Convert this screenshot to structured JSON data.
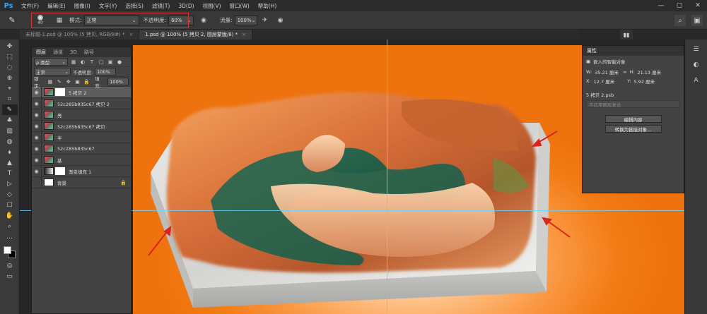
{
  "menu": {
    "logo": "Ps",
    "items": [
      "文件(F)",
      "编辑(E)",
      "图像(I)",
      "文字(Y)",
      "选择(S)",
      "滤镜(T)",
      "3D(D)",
      "视图(V)",
      "窗口(W)",
      "帮助(H)"
    ],
    "controls": [
      "—",
      "▢",
      "✕"
    ]
  },
  "options": {
    "brush_size": "40",
    "mode_label": "模式:",
    "mode_value": "正常",
    "opacity_label": "不透明度:",
    "opacity_value": "60%",
    "flow_label": "流量:",
    "flow_value": "100%"
  },
  "tabs": [
    {
      "label": "未标题-1.psd @ 100% (5 拷贝, RGB/8#) *",
      "close": "×"
    },
    {
      "label": "1.psd @ 100% (5 拷贝 2, 图层蒙版/8) *",
      "close": "×"
    }
  ],
  "layers_panel": {
    "tabs": [
      "图层",
      "通道",
      "3D",
      "路径"
    ],
    "filter_label": "ρ 类型",
    "blend_mode": "正常",
    "opacity_label": "不透明度:",
    "opacity_value": "100%",
    "lock_label": "锁定:",
    "fill_label": "填充:",
    "fill_value": "100%",
    "layers": [
      {
        "name": "5 拷贝 2",
        "thumb": "photo",
        "mask": true
      },
      {
        "name": "52c285b835c67 拷贝 2",
        "thumb": "photo"
      },
      {
        "name": "亮",
        "thumb": "photo"
      },
      {
        "name": "52c285b835c67 拷贝",
        "thumb": "photo"
      },
      {
        "name": "半",
        "thumb": "photo"
      },
      {
        "name": "52c285b835c67",
        "thumb": "photo"
      },
      {
        "name": "基",
        "thumb": "photo"
      },
      {
        "name": "渐变填充 1",
        "thumb": "grad"
      },
      {
        "name": "背景",
        "thumb": "white"
      }
    ]
  },
  "properties_panel": {
    "title": "属性",
    "subtitle": "嵌入的智能对象",
    "w_label": "W:",
    "w_value": "35.21 厘米",
    "h_label": "H:",
    "h_value": "21.13 厘米",
    "x_label": "X:",
    "x_value": "12.7 厘米",
    "y_label": "Y:",
    "y_value": "5.92 厘米",
    "file_name": "5 拷贝 2.psb",
    "comp_placeholder": "不应用图层复合",
    "edit_button": "编辑内容",
    "convert_button": "转换为链接对象..."
  },
  "tools": [
    "✥",
    "⬚",
    "◌",
    "⊕",
    "⌖",
    "⌗",
    "✎",
    "♣",
    "▥",
    "◍",
    "⬧",
    "▲",
    "T",
    "▷",
    "◇",
    "☐",
    "✋",
    "⌕",
    "…"
  ],
  "colors": {
    "accent": "#31a8ff",
    "canvas_orange": "#f27b14",
    "arrow": "#d9261c",
    "guide": "#63d4ff"
  }
}
